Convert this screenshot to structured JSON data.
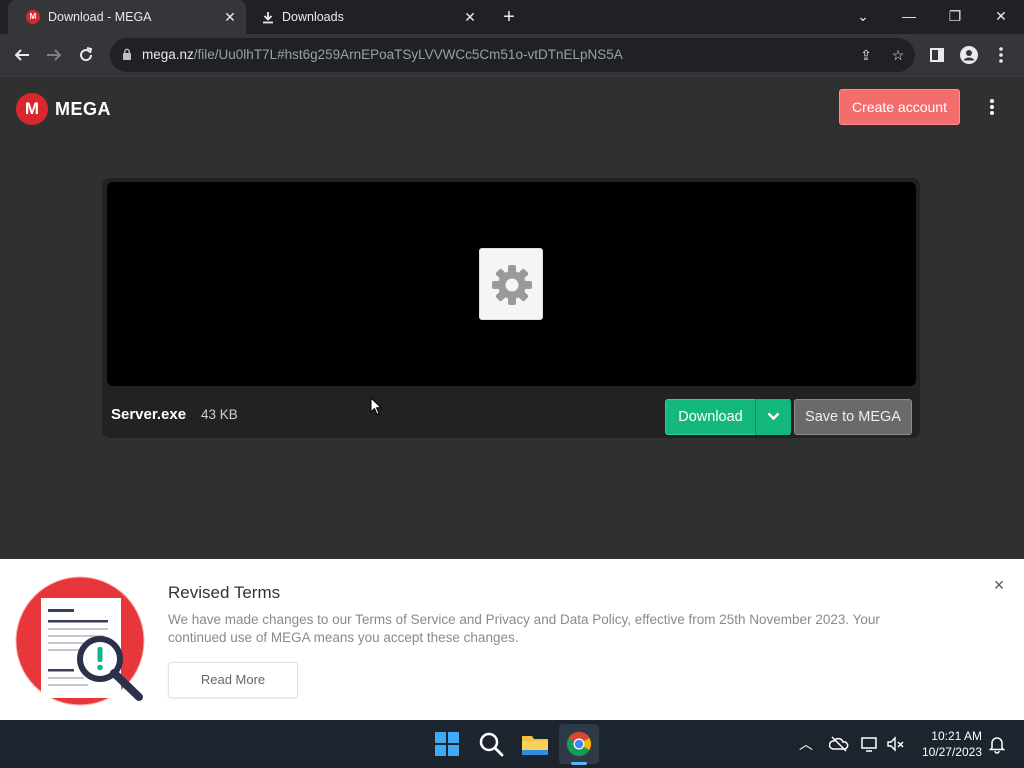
{
  "browser": {
    "tabs": [
      {
        "title": "Download - MEGA",
        "favicon": "M",
        "active": true
      },
      {
        "title": "Downloads",
        "favicon": "download-icon",
        "active": false
      }
    ],
    "new_tab_symbol": "+",
    "url_host": "mega.nz",
    "url_path": "/file/Uu0lhT7L#hst6g259ArnEPoaTSyLVVWCc5Cm51o-vtDTnELpNS5A"
  },
  "site": {
    "logo_mark": "M",
    "logo_text": "MEGA",
    "create_account_label": "Create account",
    "accent_color": "#d9272e"
  },
  "file": {
    "name": "Server.exe",
    "size": "43 KB",
    "download_label": "Download",
    "save_label": "Save to MEGA"
  },
  "banner": {
    "title": "Revised Terms",
    "text": "We have made changes to our Terms of Service and Privacy and Data Policy, effective from 25th November 2023. Your continued use of MEGA means you accept these changes.",
    "read_more_label": "Read More",
    "close_symbol": "×"
  },
  "taskbar": {
    "time": "10:21 AM",
    "date": "10/27/2023"
  }
}
